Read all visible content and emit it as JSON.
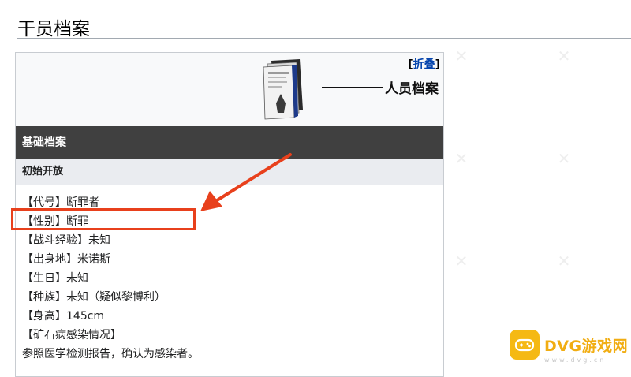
{
  "page": {
    "section_title": "干员档案"
  },
  "infobox": {
    "collapse_left": "[",
    "collapse_label": "折叠",
    "collapse_right": "]",
    "dossier_title": "人员档案",
    "basic_header": "基础档案",
    "initial_header": "初始开放",
    "fields": [
      "【代号】断罪者",
      "【性别】断罪",
      "【战斗经验】未知",
      "【出身地】米诺斯",
      "【生日】未知",
      "【种族】未知（疑似黎博利）",
      "【身高】145cm",
      "【矿石病感染情况】",
      "参照医学检测报告，确认为感染者。"
    ]
  },
  "annotation": {
    "color": "#e8401c"
  },
  "watermark": {
    "brand": "DVG游戏网",
    "domain": "www.dvg.cn",
    "color": "#f5b914"
  }
}
